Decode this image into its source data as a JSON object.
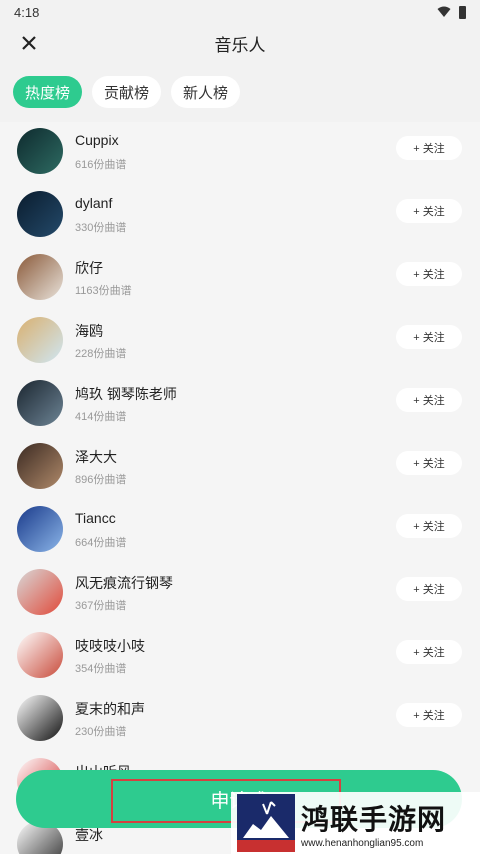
{
  "status_bar": {
    "time": "4:18"
  },
  "header": {
    "title": "音乐人"
  },
  "tabs": [
    {
      "label": "热度榜",
      "active": true
    },
    {
      "label": "贡献榜",
      "active": false
    },
    {
      "label": "新人榜",
      "active": false
    }
  ],
  "follow_label": "+ 关注",
  "musicians": [
    {
      "name": "Cuppix",
      "count": "616份曲谱",
      "avatar_colors": [
        "#0e2a2e",
        "#2e6b62"
      ]
    },
    {
      "name": "dylanf",
      "count": "330份曲谱",
      "avatar_colors": [
        "#0a1c2e",
        "#244a6a"
      ]
    },
    {
      "name": "欣仔",
      "count": "1163份曲谱",
      "avatar_colors": [
        "#8a5a3a",
        "#e8e2da"
      ]
    },
    {
      "name": "海鸥",
      "count": "228份曲谱",
      "avatar_colors": [
        "#d9b070",
        "#cfe6f2"
      ]
    },
    {
      "name": "鸠玖 钢琴陈老师",
      "count": "414份曲谱",
      "avatar_colors": [
        "#1b2630",
        "#6d8495"
      ]
    },
    {
      "name": "泽大大",
      "count": "896份曲谱",
      "avatar_colors": [
        "#3b2a22",
        "#b08a6a"
      ]
    },
    {
      "name": "Tiancc",
      "count": "664份曲谱",
      "avatar_colors": [
        "#1a3a8a",
        "#8bb5e8"
      ]
    },
    {
      "name": "风无痕流行钢琴",
      "count": "367份曲谱",
      "avatar_colors": [
        "#d8d8d8",
        "#e04a3a"
      ]
    },
    {
      "name": "吱吱吱小吱",
      "count": "354份曲谱",
      "avatar_colors": [
        "#ffffff",
        "#c84a3a"
      ]
    },
    {
      "name": "夏末的和声",
      "count": "230份曲谱",
      "avatar_colors": [
        "#ffffff",
        "#111111"
      ]
    },
    {
      "name": "出山听风",
      "count": "",
      "avatar_colors": [
        "#ffffff",
        "#d03030"
      ]
    },
    {
      "name": "壹冰",
      "count": "",
      "avatar_colors": [
        "#ffffff",
        "#333333"
      ]
    }
  ],
  "apply_button": {
    "label": "申请成"
  },
  "watermark": {
    "title": "鸿联手游网",
    "url": "www.henanhonglian95.com"
  },
  "colors": {
    "accent": "#2ecb8f",
    "highlight": "#d64040"
  }
}
